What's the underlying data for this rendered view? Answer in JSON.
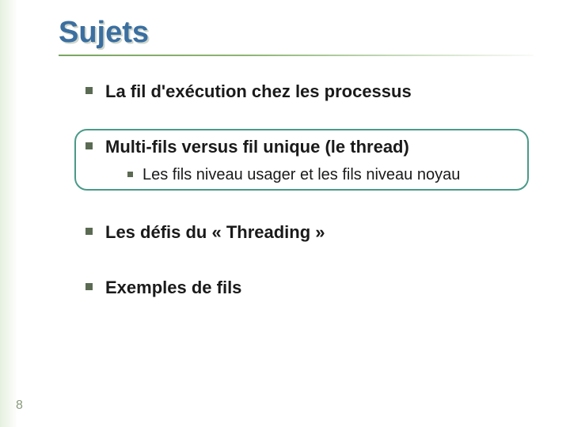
{
  "slide": {
    "title": "Sujets",
    "page_number": "8",
    "bullets": {
      "b1": "La fil d'exécution chez les processus",
      "b2": "Multi-fils versus fil unique (le thread)",
      "b2_sub1": "Les fils niveau usager et les fils niveau noyau",
      "b3": "Les défis du « Threading »",
      "b4": "Exemples de fils"
    }
  }
}
